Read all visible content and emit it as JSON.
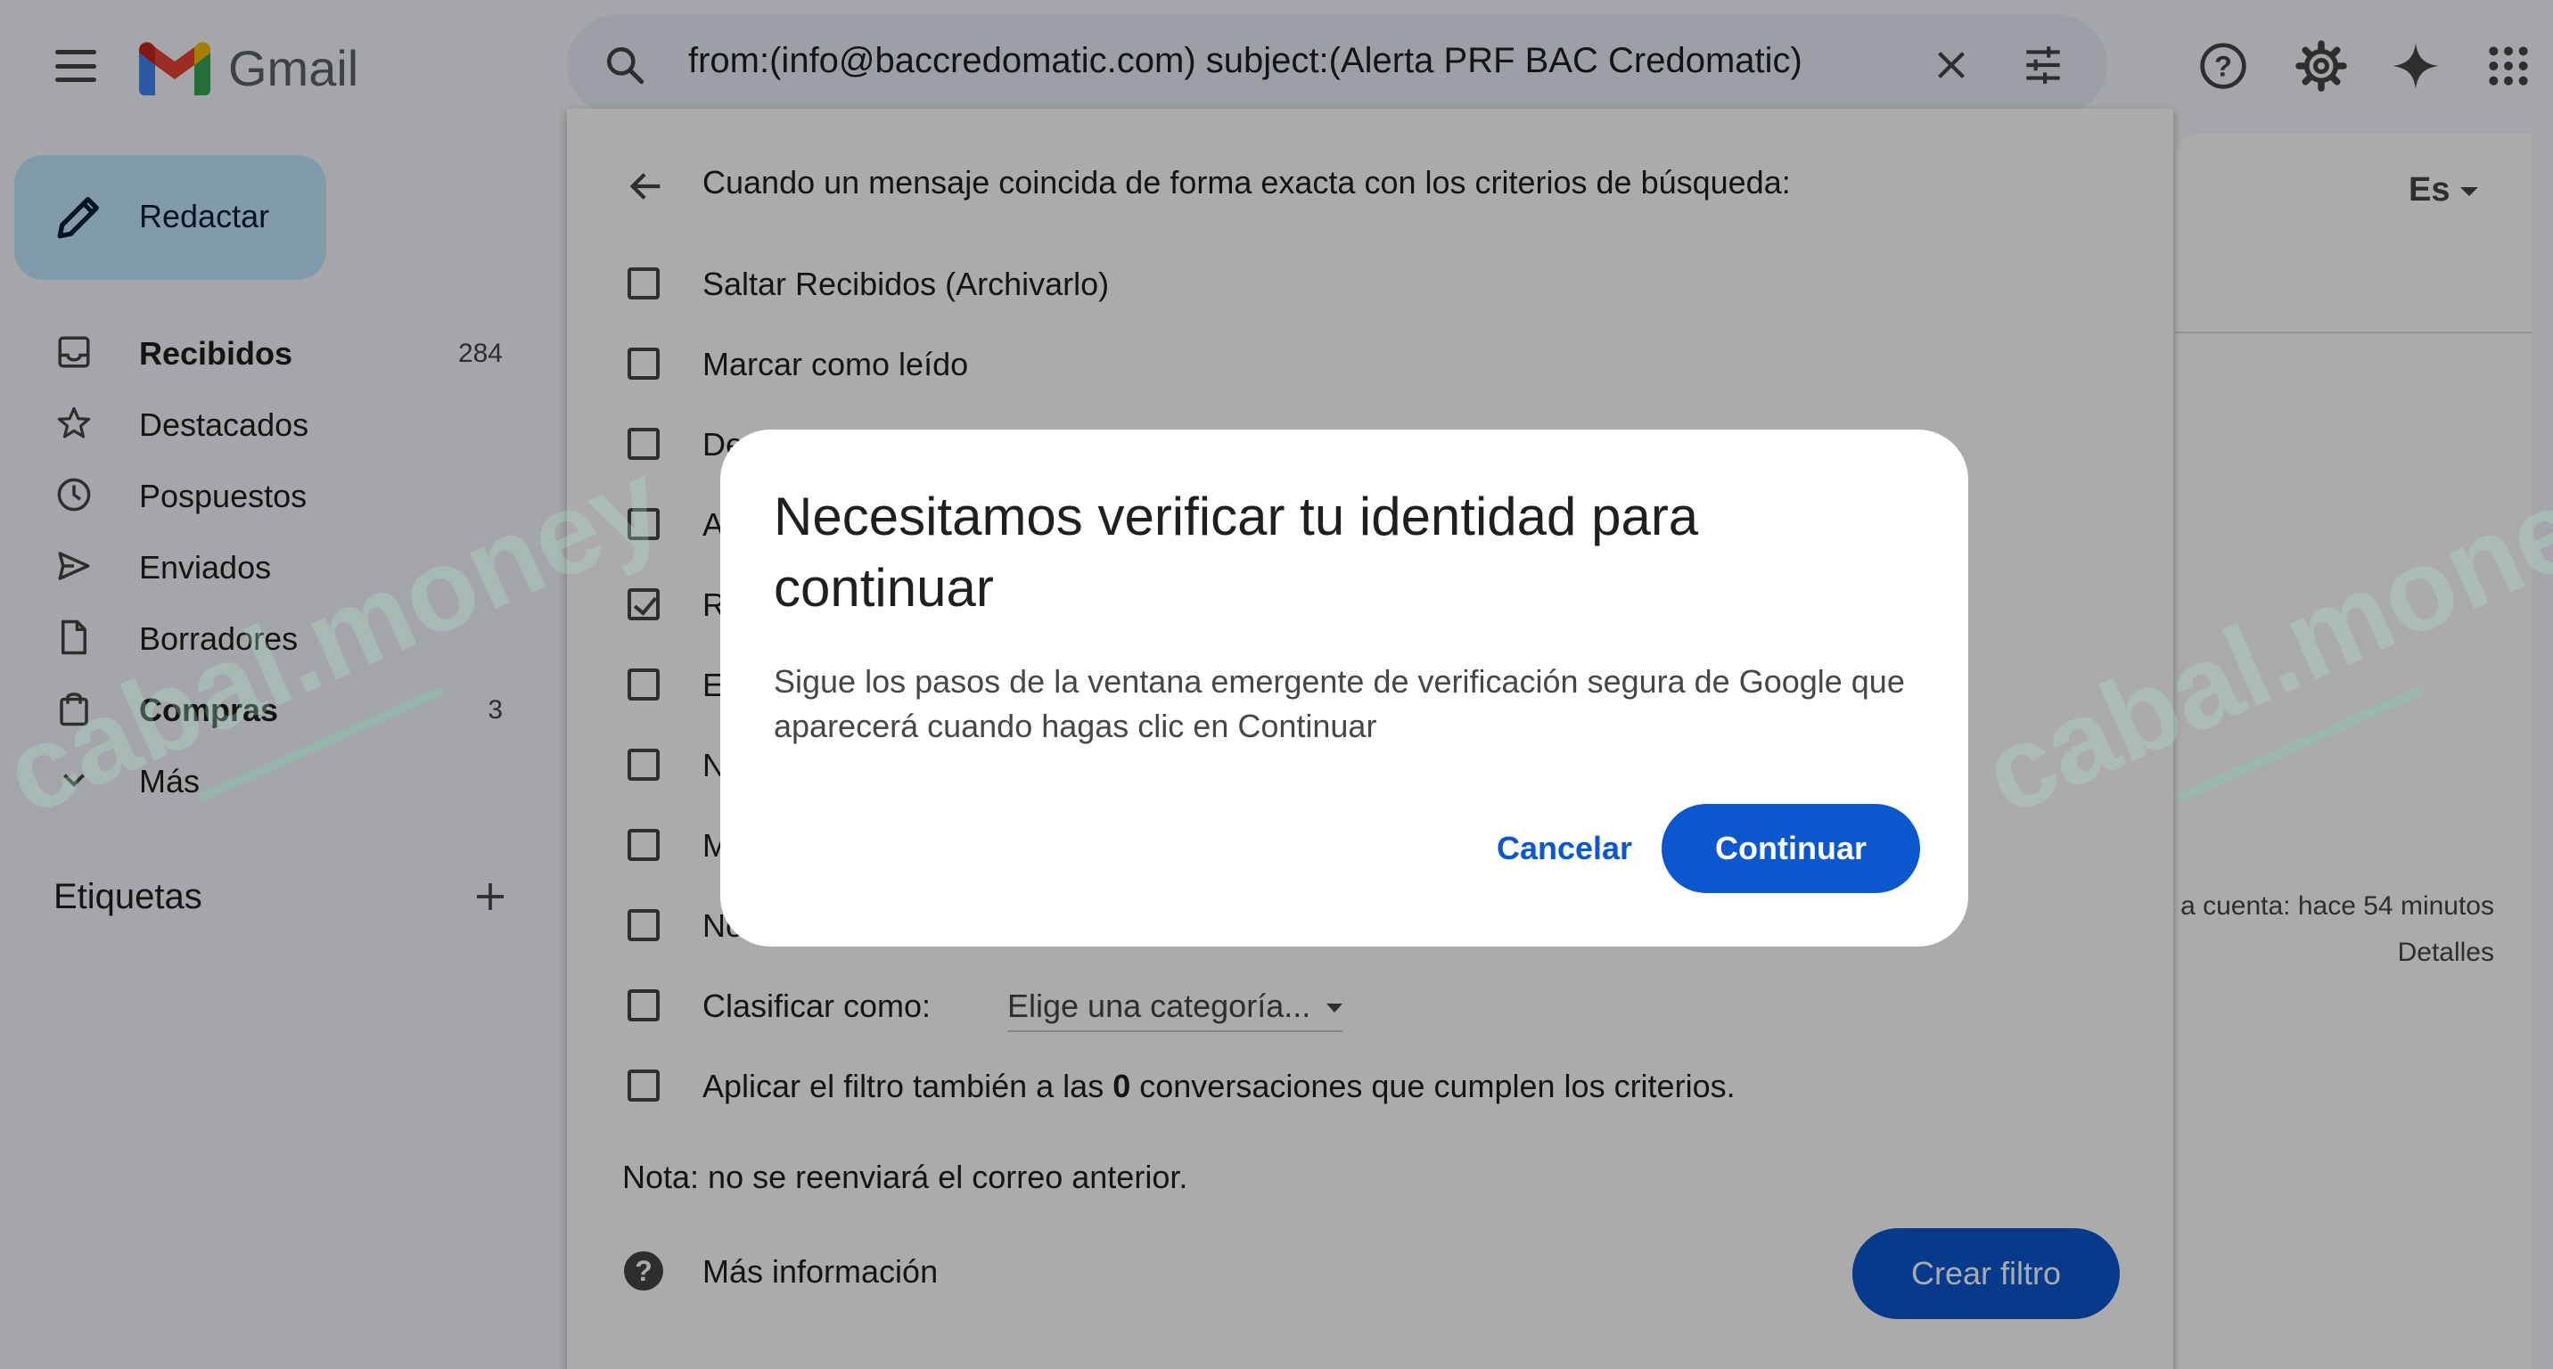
{
  "app": {
    "name": "Gmail",
    "search_query": "from:(info@baccredomatic.com) subject:(Alerta PRF BAC Credomatic)"
  },
  "colors": {
    "accent": "#0b57d0",
    "compose_bg": "#c2e7ff",
    "gmail_red": "#ea4335",
    "gmail_blue": "#4285f4",
    "gmail_green": "#34a853",
    "gmail_yellow": "#fbbc04"
  },
  "sidebar": {
    "compose_label": "Redactar",
    "items": [
      {
        "label": "Recibidos",
        "count": "284",
        "icon": "inbox-icon",
        "bold": true
      },
      {
        "label": "Destacados",
        "count": "",
        "icon": "star-icon",
        "bold": false
      },
      {
        "label": "Pospuestos",
        "count": "",
        "icon": "clock-icon",
        "bold": false
      },
      {
        "label": "Enviados",
        "count": "",
        "icon": "send-icon",
        "bold": false
      },
      {
        "label": "Borradores",
        "count": "",
        "icon": "draft-icon",
        "bold": false
      },
      {
        "label": "Compras",
        "count": "3",
        "icon": "shopping-icon",
        "bold": true
      },
      {
        "label": "Más",
        "count": "",
        "icon": "chevron-down-icon",
        "bold": false
      }
    ],
    "labels_title": "Etiquetas"
  },
  "right_panel": {
    "language": "Es",
    "activity": "a cuenta: hace 54 minutos",
    "details": "Detalles"
  },
  "filter": {
    "header": "Cuando un mensaje coincida de forma exacta con los criterios de búsqueda:",
    "options": [
      {
        "label": "Saltar Recibidos (Archivarlo)",
        "checked": false
      },
      {
        "label": "Marcar como leído",
        "checked": false
      },
      {
        "label": "Des",
        "checked": false
      },
      {
        "label": "A",
        "checked": false
      },
      {
        "label": "R",
        "checked": true
      },
      {
        "label": "E",
        "checked": false
      },
      {
        "label": "N",
        "checked": false
      },
      {
        "label": "M",
        "checked": false
      },
      {
        "label": "No",
        "checked": false
      }
    ],
    "categorize_label": "Clasificar como:",
    "categorize_placeholder": "Elige una categoría...",
    "apply_prefix": "Aplicar el filtro también a las",
    "apply_count": "0",
    "apply_suffix": "conversaciones que cumplen los criterios.",
    "note": "Nota: no se reenviará el correo anterior.",
    "help_label": "Más información",
    "create_button": "Crear filtro"
  },
  "dialog": {
    "title": "Necesitamos verificar tu identidad para continuar",
    "body": "Sigue los pasos de la ventana emergente de verificación segura de Google que aparecerá cuando hagas clic en Continuar",
    "cancel": "Cancelar",
    "continue": "Continuar"
  }
}
